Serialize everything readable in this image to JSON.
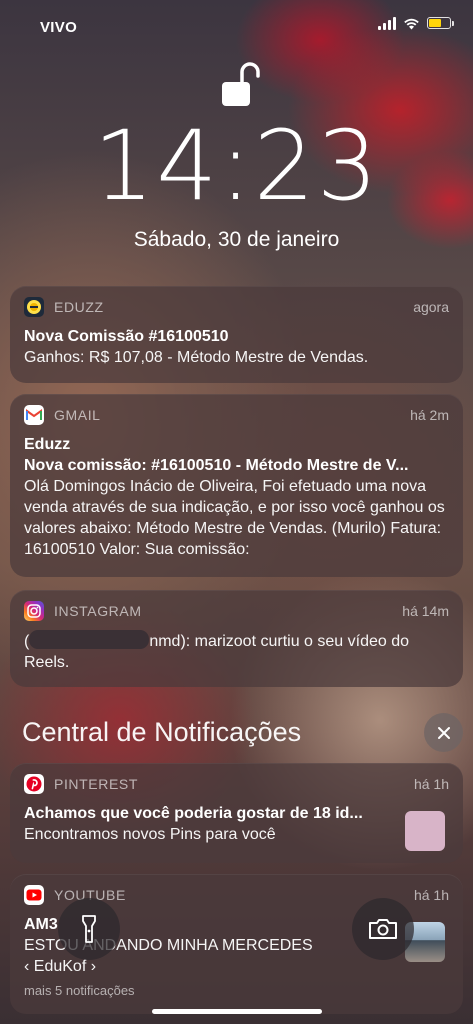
{
  "status_bar": {
    "carrier": "VIVO",
    "battery_level": 0.6,
    "battery_color": "#ffd60a"
  },
  "lock": {
    "time": "14:23",
    "date": "Sábado, 30 de janeiro"
  },
  "notifications": [
    {
      "app": "EDUZZ",
      "time": "agora",
      "icon": "eduzz-logo-icon",
      "title": "Nova Comissão #16100510",
      "body": "Ganhos: R$ 107,08 - Método Mestre de Vendas."
    },
    {
      "app": "GMAIL",
      "time": "há 2m",
      "icon": "gmail-logo-icon",
      "title": "Eduzz",
      "subtitle": "Nova comissão: #16100510 - Método Mestre de V...",
      "body": "Olá Domingos Inácio de Oliveira, Foi efetuado uma nova venda através de sua indicação, e por isso você ganhou os valores abaixo: Método Mestre de Vendas. (Murilo) Fatura: 16100510 Valor: Sua comissão:"
    },
    {
      "app": "INSTAGRAM",
      "time": "há 14m",
      "icon": "instagram-logo-icon",
      "body_prefix": "(",
      "body_suffix": "nmd): marizoot curtiu o seu vídeo do Reels."
    }
  ],
  "notification_center": {
    "title": "Central de Notificações"
  },
  "center_notifications": [
    {
      "app": "PINTEREST",
      "time": "há 1h",
      "icon": "pinterest-logo-icon",
      "title": "Achamos que você poderia gostar de 18 id...",
      "body": "Encontramos novos Pins para você",
      "thumb_color": "#d8b4c8"
    },
    {
      "app": "YOUTUBE",
      "time": "há 1h",
      "icon": "youtube-logo-icon",
      "title": "AM3",
      "body": "ESTOU ANDANDO MINHA MERCEDES",
      "channel": "‹ EduKof ›",
      "more": "mais 5 notificações"
    }
  ],
  "colors": {
    "accent_pinterest": "#e60023",
    "accent_youtube": "#ff0000",
    "card_bg": "rgba(75,58,60,.72)"
  }
}
